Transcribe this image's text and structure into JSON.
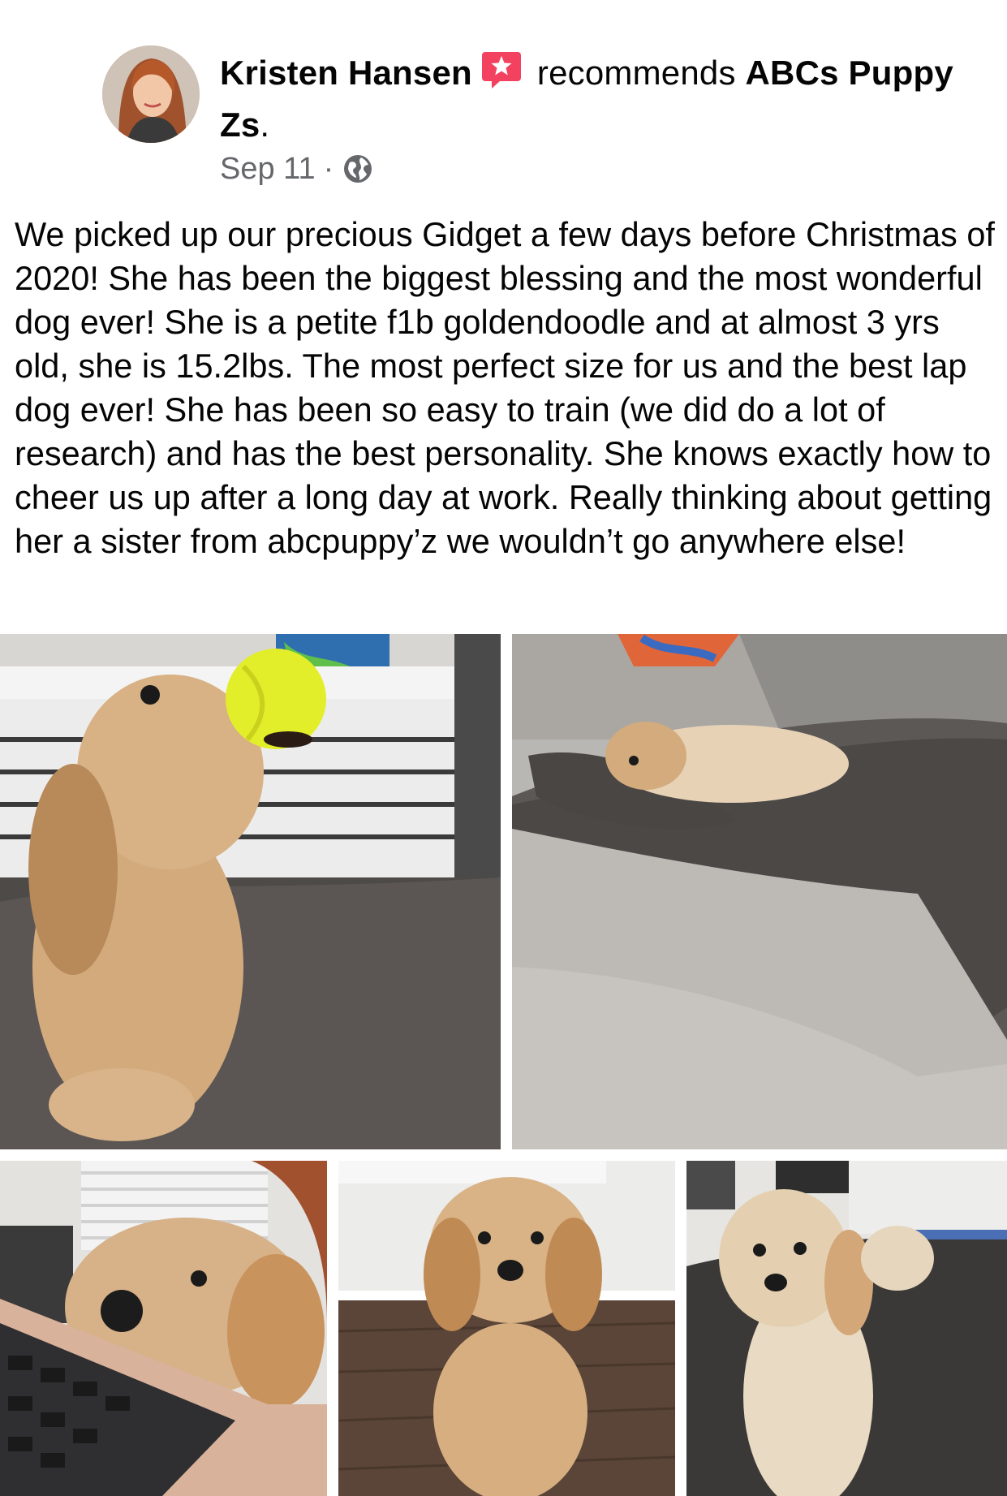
{
  "post": {
    "author": "Kristen Hansen",
    "verb": "recommends",
    "page_name": "ABCs Puppy Zs",
    "period": ".",
    "date": "Sep 11",
    "separator": "·",
    "body": "We picked up our precious Gidget a few days before Christmas of 2020! She has been the biggest blessing and the most wonderful dog ever! She is a petite f1b goldendoodle and at almost 3 yrs old, she is 15.2lbs. The most perfect size for us and the best lap dog ever! She has been so easy to train (we did do a lot of research) and has the best personality. She knows exactly how to cheer us up after a long day at work. Really thinking about getting her a sister from abcpuppy’z we wouldn’t go anywhere else!",
    "icons": {
      "recommend": "recommend-star-icon",
      "audience": "globe-icon"
    },
    "colors": {
      "recommend_icon": "#f3425f",
      "meta_text": "#65676b",
      "text": "#050505"
    },
    "photos": [
      {
        "id": "photo-dog-tennis-ball"
      },
      {
        "id": "photo-dog-on-couch"
      },
      {
        "id": "photo-dog-on-laptop"
      },
      {
        "id": "photo-dog-sitting-floor"
      },
      {
        "id": "photo-dog-on-blanket"
      }
    ]
  }
}
